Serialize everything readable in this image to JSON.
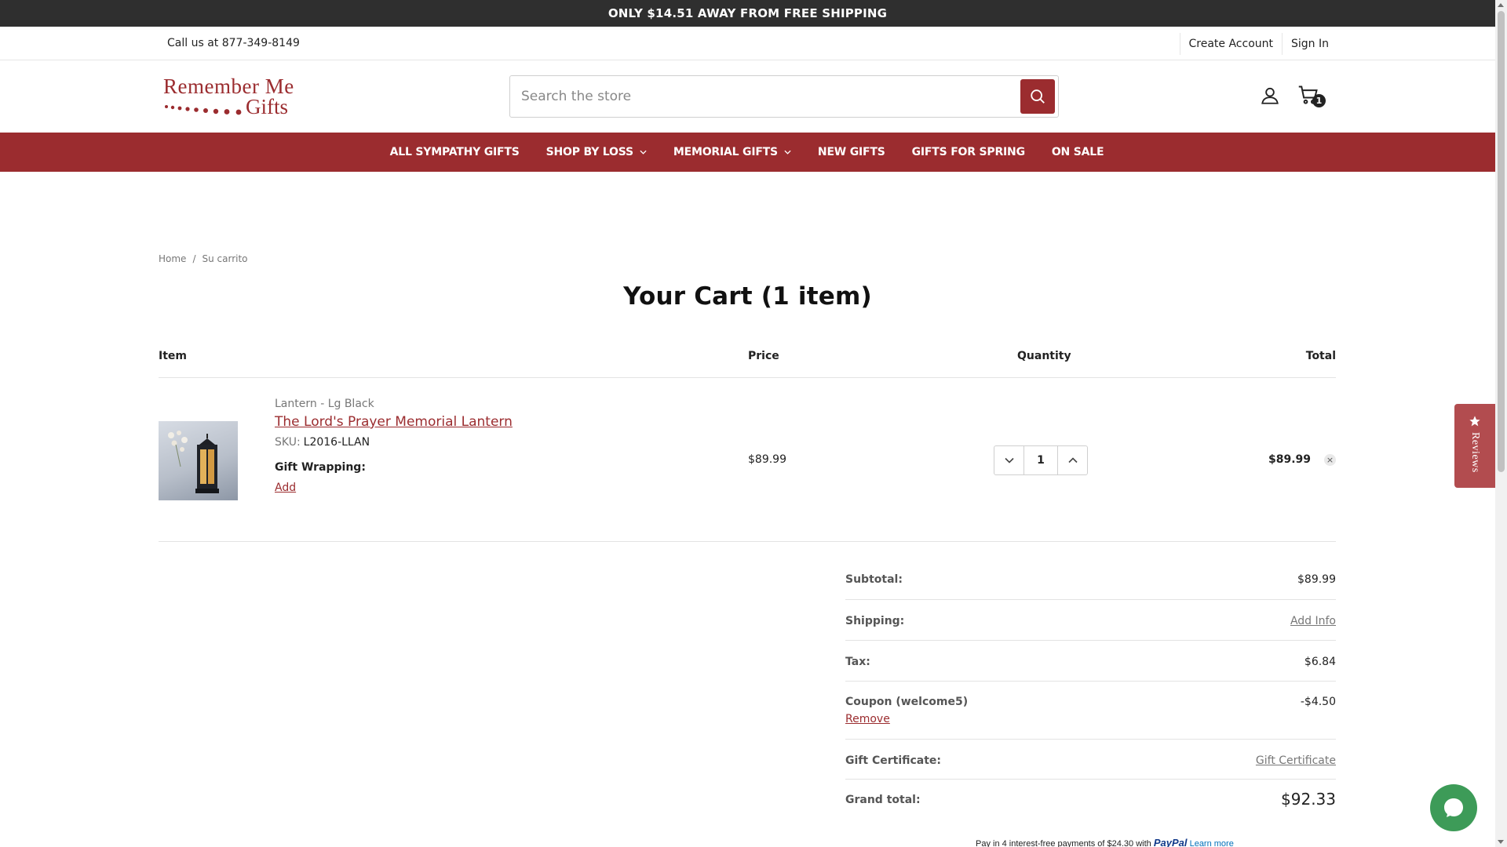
{
  "promo": {
    "text": "ONLY $14.51 AWAY FROM FREE SHIPPING"
  },
  "utility": {
    "phone": "Call us at 877-349-8149",
    "create_account": "Create Account",
    "sign_in": "Sign In"
  },
  "header": {
    "logo_line1": "Remember Me",
    "logo_line2": "Gifts",
    "search_placeholder": "Search the store",
    "cart_count": "1"
  },
  "nav": {
    "items": [
      {
        "label": "ALL SYMPATHY GIFTS",
        "has_dropdown": false
      },
      {
        "label": "SHOP BY LOSS",
        "has_dropdown": true
      },
      {
        "label": "MEMORIAL GIFTS",
        "has_dropdown": true
      },
      {
        "label": "NEW GIFTS",
        "has_dropdown": false
      },
      {
        "label": "GIFTS FOR SPRING",
        "has_dropdown": false
      },
      {
        "label": "ON SALE",
        "has_dropdown": false
      }
    ]
  },
  "breadcrumb": {
    "home": "Home",
    "separator": "/",
    "current": "Su carrito"
  },
  "page_title": "Your Cart (1 item)",
  "cart": {
    "headers": {
      "item": "Item",
      "price": "Price",
      "quantity": "Quantity",
      "total": "Total"
    },
    "items": [
      {
        "variant": "Lantern - Lg Black",
        "name": "The Lord's Prayer Memorial Lantern",
        "sku_label": "SKU:",
        "sku": "L2016-LLAN",
        "gift_wrapping_label": "Gift Wrapping:",
        "gift_wrapping_action": "Add",
        "price": "$89.99",
        "quantity": "1",
        "total": "$89.99",
        "remove_glyph": "×"
      }
    ]
  },
  "totals": {
    "subtotal_label": "Subtotal:",
    "subtotal": "$89.99",
    "shipping_label": "Shipping:",
    "shipping_action": "Add Info",
    "tax_label": "Tax:",
    "tax": "$6.84",
    "coupon_label": "Coupon (welcome5)",
    "coupon_value": "-$4.50",
    "coupon_remove": "Remove",
    "gift_cert_label": "Gift Certificate:",
    "gift_cert_action": "Gift Certificate",
    "grand_label": "Grand total:",
    "grand": "$92.33"
  },
  "paypal": {
    "text": "Pay in 4 interest-free payments of $24.30 with",
    "brand": "PayPal",
    "learn_more": "Learn more"
  },
  "reviews_tab": {
    "label": "Reviews"
  },
  "colors": {
    "brand": "#9b2c2f",
    "promo_bg": "#2f2f2f",
    "chat": "#3d9b58",
    "reviews_tab": "#b24c4f"
  }
}
